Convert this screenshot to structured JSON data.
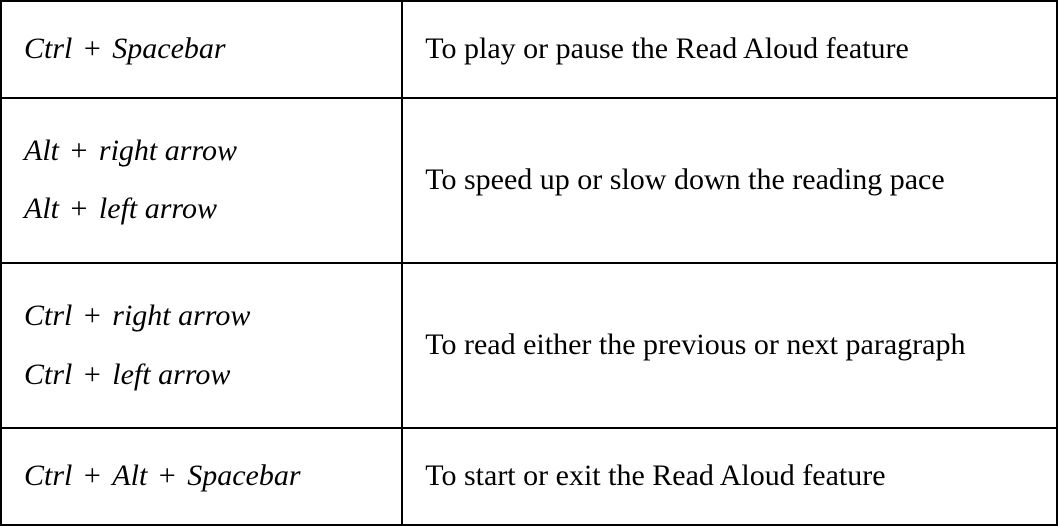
{
  "rows": [
    {
      "shortcuts": [
        {
          "key1": "Ctrl",
          "plus1": "+",
          "key2": "Spacebar"
        }
      ],
      "description": "To play or pause the Read Aloud feature"
    },
    {
      "shortcuts": [
        {
          "key1": "Alt",
          "plus1": "+",
          "key2": "right arrow"
        },
        {
          "key1": "Alt",
          "plus1": "+",
          "key2": "left arrow"
        }
      ],
      "description": "To speed up or slow down the reading pace"
    },
    {
      "shortcuts": [
        {
          "key1": "Ctrl",
          "plus1": "+",
          "key2": "right arrow"
        },
        {
          "key1": "Ctrl",
          "plus1": "+",
          "key2": "left arrow"
        }
      ],
      "description": "To read either the previous or next paragraph"
    },
    {
      "shortcuts": [
        {
          "key1": "Ctrl",
          "plus1": "+",
          "key2": "Alt",
          "plus2": "+",
          "key3": "Spacebar"
        }
      ],
      "description": "To start or exit the Read Aloud feature"
    }
  ]
}
